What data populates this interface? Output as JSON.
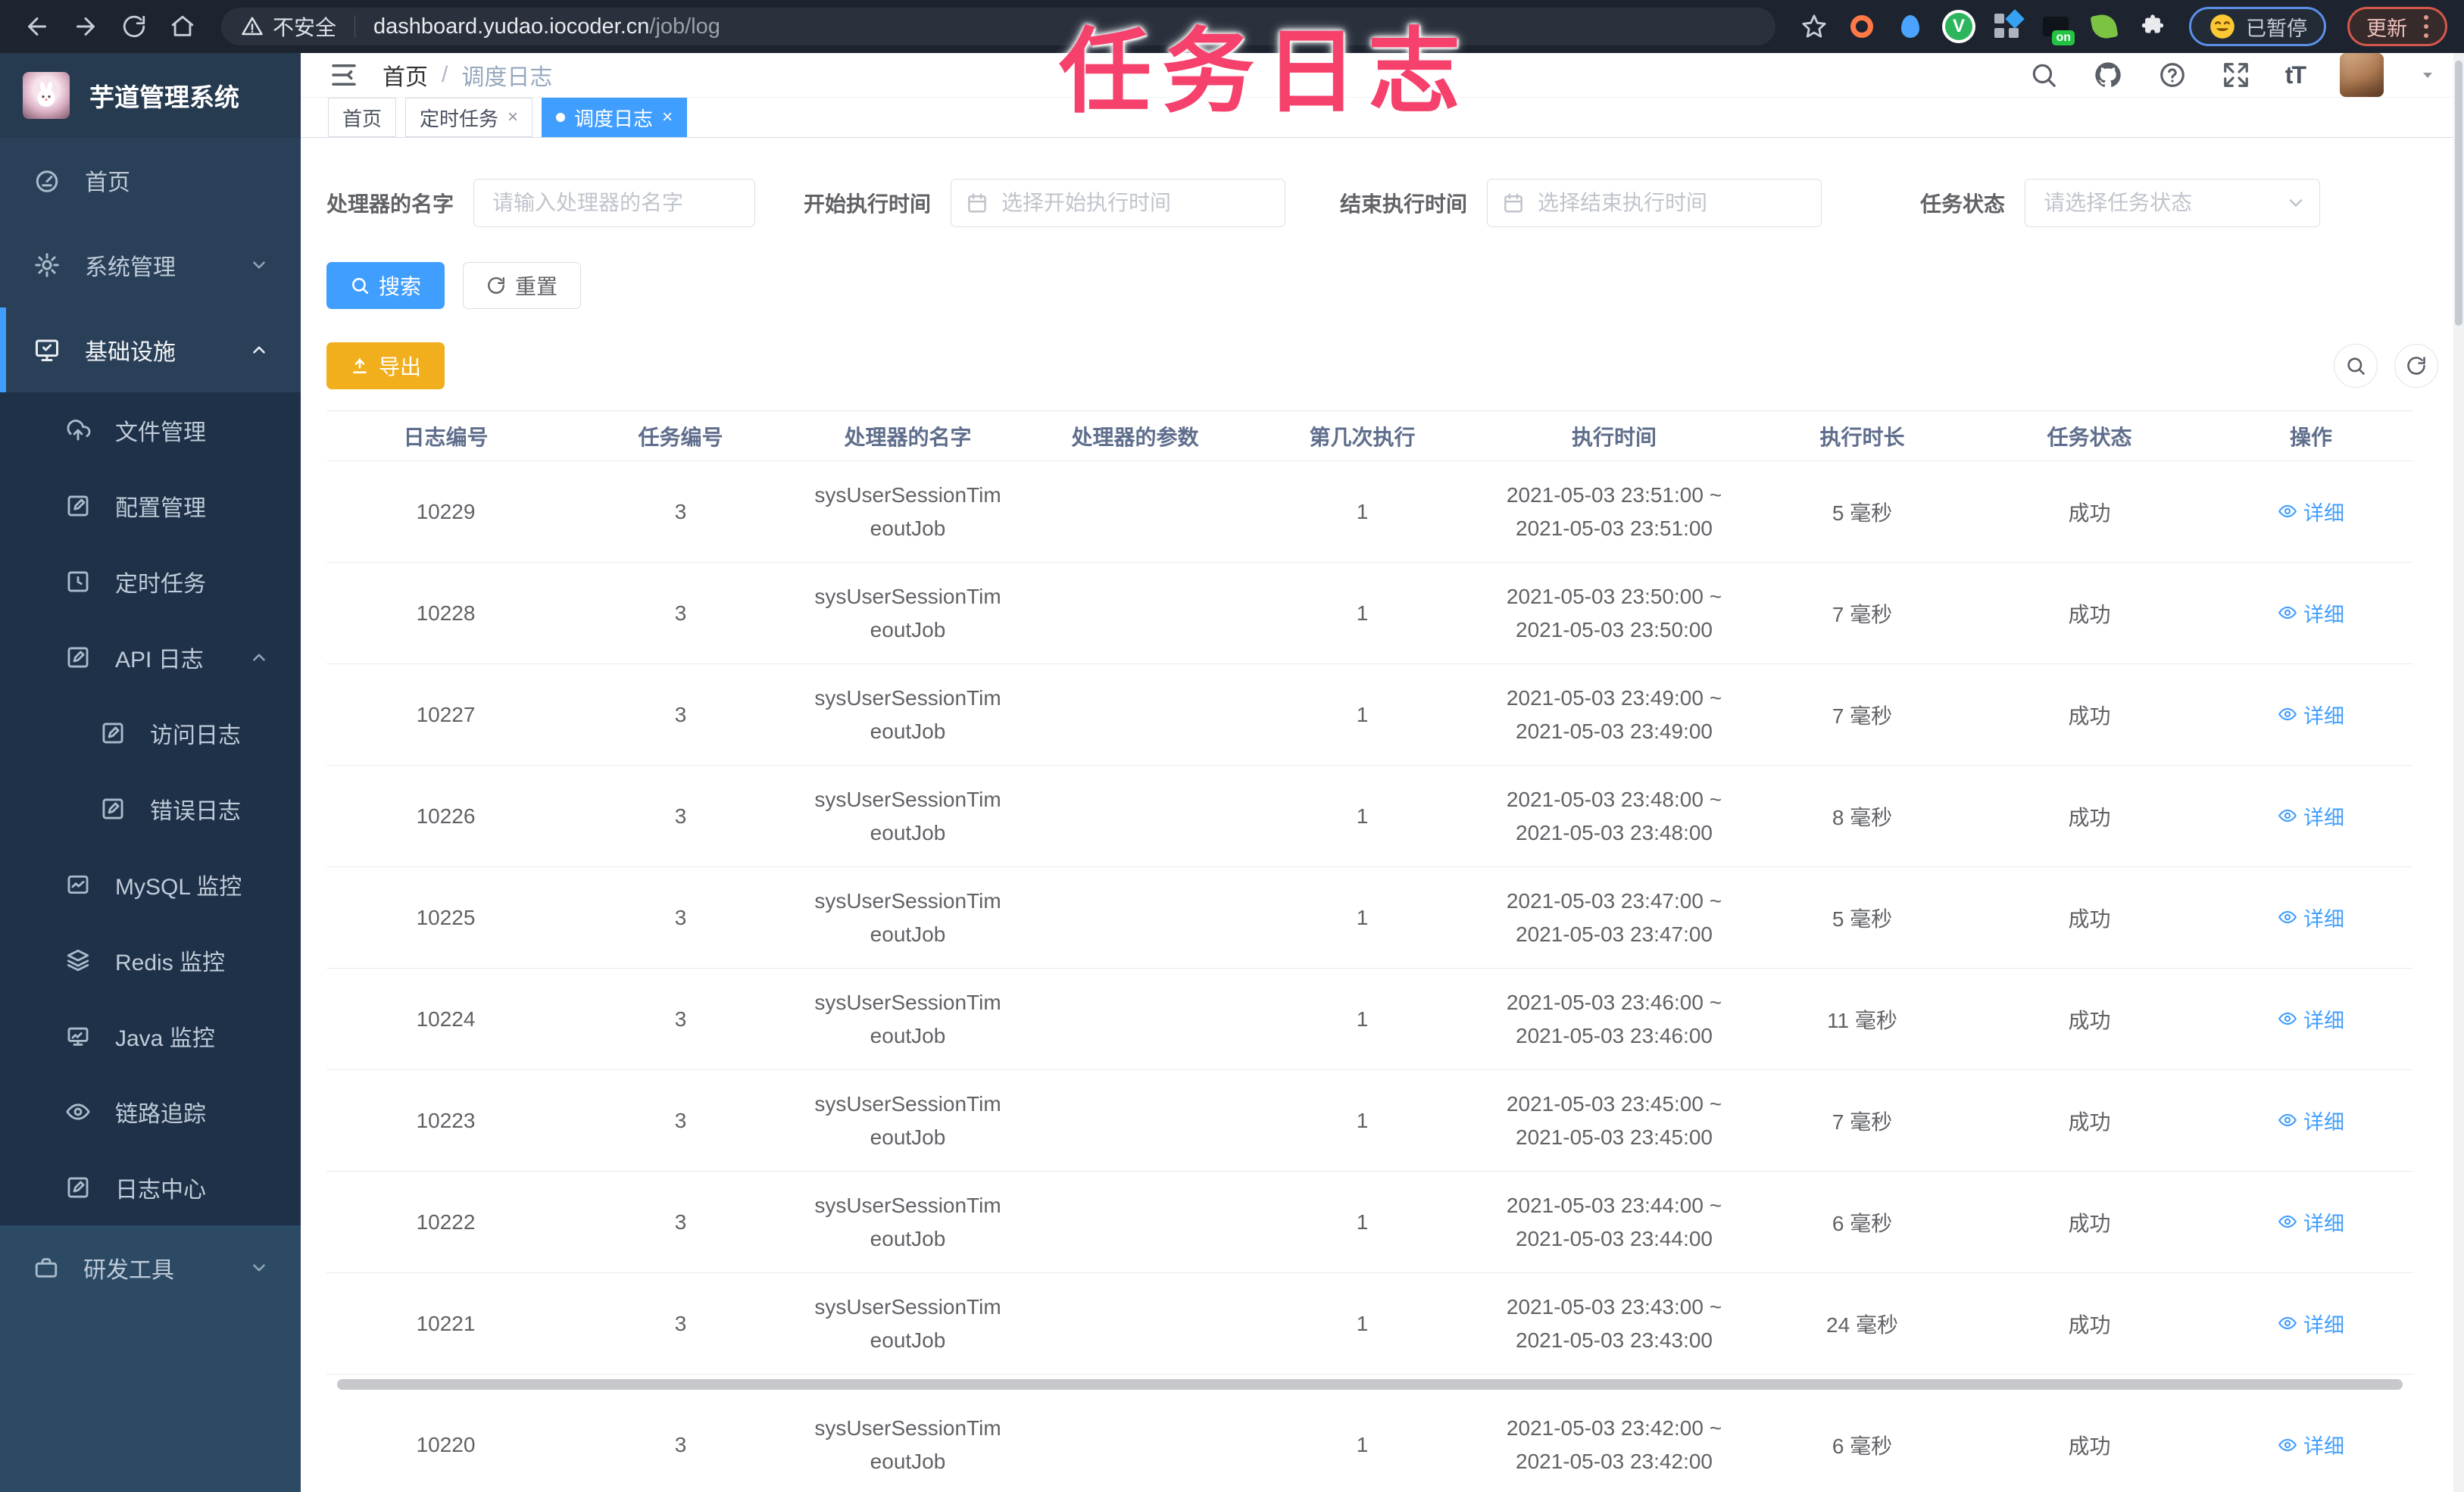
{
  "overlay": {
    "text": "任务日志"
  },
  "browser": {
    "security_label": "不安全",
    "url_host": "dashboard.yudao.iocoder.cn",
    "url_path": "/job/log",
    "extension_badge": "on",
    "paused_label": "已暂停",
    "update_label": "更新"
  },
  "sidebar": {
    "title": "芋道管理系统",
    "items": [
      {
        "label": "首页"
      },
      {
        "label": "系统管理"
      },
      {
        "label": "基础设施"
      },
      {
        "label": "文件管理"
      },
      {
        "label": "配置管理"
      },
      {
        "label": "定时任务"
      },
      {
        "label": "API 日志"
      },
      {
        "label": "访问日志"
      },
      {
        "label": "错误日志"
      },
      {
        "label": "MySQL 监控"
      },
      {
        "label": "Redis 监控"
      },
      {
        "label": "Java 监控"
      },
      {
        "label": "链路追踪"
      },
      {
        "label": "日志中心"
      },
      {
        "label": "研发工具"
      }
    ]
  },
  "breadcrumb": {
    "home": "首页",
    "separator": "/",
    "current": "调度日志"
  },
  "tabbar": {
    "close_glyph": "×"
  },
  "tabs": [
    {
      "label": "首页"
    },
    {
      "label": "定时任务"
    },
    {
      "label": "调度日志"
    }
  ],
  "filters": {
    "handler": {
      "label": "处理器的名字",
      "placeholder": "请输入处理器的名字"
    },
    "start_time": {
      "label": "开始执行时间",
      "placeholder": "选择开始执行时间"
    },
    "end_time": {
      "label": "结束执行时间",
      "placeholder": "选择结束执行时间"
    },
    "status": {
      "label": "任务状态",
      "placeholder": "请选择任务状态"
    }
  },
  "actions": {
    "search": "搜索",
    "reset": "重置",
    "export": "导出"
  },
  "table": {
    "headers": [
      "日志编号",
      "任务编号",
      "处理器的名字",
      "处理器的参数",
      "第几次执行",
      "执行时间",
      "执行时长",
      "任务状态",
      "操作"
    ],
    "action_label": "详细",
    "rows": [
      {
        "log_id": "10229",
        "job_id": "3",
        "handler_line1": "sysUserSessionTim",
        "handler_line2": "eoutJob",
        "param": "",
        "execute_index": "1",
        "time_line1": "2021-05-03 23:51:00 ~",
        "time_line2": "2021-05-03 23:51:00",
        "duration": "5 毫秒",
        "status": "成功"
      },
      {
        "log_id": "10228",
        "job_id": "3",
        "handler_line1": "sysUserSessionTim",
        "handler_line2": "eoutJob",
        "param": "",
        "execute_index": "1",
        "time_line1": "2021-05-03 23:50:00 ~",
        "time_line2": "2021-05-03 23:50:00",
        "duration": "7 毫秒",
        "status": "成功"
      },
      {
        "log_id": "10227",
        "job_id": "3",
        "handler_line1": "sysUserSessionTim",
        "handler_line2": "eoutJob",
        "param": "",
        "execute_index": "1",
        "time_line1": "2021-05-03 23:49:00 ~",
        "time_line2": "2021-05-03 23:49:00",
        "duration": "7 毫秒",
        "status": "成功"
      },
      {
        "log_id": "10226",
        "job_id": "3",
        "handler_line1": "sysUserSessionTim",
        "handler_line2": "eoutJob",
        "param": "",
        "execute_index": "1",
        "time_line1": "2021-05-03 23:48:00 ~",
        "time_line2": "2021-05-03 23:48:00",
        "duration": "8 毫秒",
        "status": "成功"
      },
      {
        "log_id": "10225",
        "job_id": "3",
        "handler_line1": "sysUserSessionTim",
        "handler_line2": "eoutJob",
        "param": "",
        "execute_index": "1",
        "time_line1": "2021-05-03 23:47:00 ~",
        "time_line2": "2021-05-03 23:47:00",
        "duration": "5 毫秒",
        "status": "成功"
      },
      {
        "log_id": "10224",
        "job_id": "3",
        "handler_line1": "sysUserSessionTim",
        "handler_line2": "eoutJob",
        "param": "",
        "execute_index": "1",
        "time_line1": "2021-05-03 23:46:00 ~",
        "time_line2": "2021-05-03 23:46:00",
        "duration": "11 毫秒",
        "status": "成功"
      },
      {
        "log_id": "10223",
        "job_id": "3",
        "handler_line1": "sysUserSessionTim",
        "handler_line2": "eoutJob",
        "param": "",
        "execute_index": "1",
        "time_line1": "2021-05-03 23:45:00 ~",
        "time_line2": "2021-05-03 23:45:00",
        "duration": "7 毫秒",
        "status": "成功"
      },
      {
        "log_id": "10222",
        "job_id": "3",
        "handler_line1": "sysUserSessionTim",
        "handler_line2": "eoutJob",
        "param": "",
        "execute_index": "1",
        "time_line1": "2021-05-03 23:44:00 ~",
        "time_line2": "2021-05-03 23:44:00",
        "duration": "6 毫秒",
        "status": "成功"
      },
      {
        "log_id": "10221",
        "job_id": "3",
        "handler_line1": "sysUserSessionTim",
        "handler_line2": "eoutJob",
        "param": "",
        "execute_index": "1",
        "time_line1": "2021-05-03 23:43:00 ~",
        "time_line2": "2021-05-03 23:43:00",
        "duration": "24 毫秒",
        "status": "成功"
      }
    ],
    "overflow_rows": [
      {
        "log_id": "10220",
        "job_id": "3",
        "handler_line1": "sysUserSessionTim",
        "handler_line2": "eoutJob",
        "param": "",
        "execute_index": "1",
        "time_line1": "2021-05-03 23:42:00 ~",
        "time_line2": "2021-05-03 23:42:00",
        "duration": "6 毫秒",
        "status": "成功"
      }
    ]
  }
}
